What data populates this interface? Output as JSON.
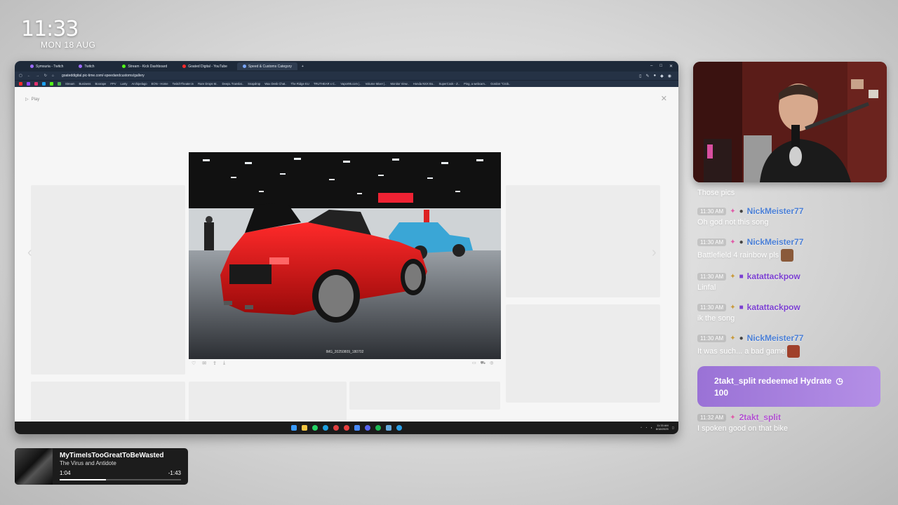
{
  "clock": {
    "time": "11:33",
    "date": "MON 18 AUG"
  },
  "browser": {
    "tabs": [
      {
        "label": "Symsuria - Twitch",
        "active": false
      },
      {
        "label": "Twitch",
        "active": false
      },
      {
        "label": "Stream - Kick Dashboard",
        "active": false
      },
      {
        "label": "Goated Digital - YouTube",
        "active": false
      },
      {
        "label": "Speed & Customs Category",
        "active": true
      }
    ],
    "new_tab": "+",
    "url": "goateddigital.pic-time.com/-speedandcustoms/gallery",
    "bookmarks": [
      "Stream",
      "Business",
      "Boorape",
      "FPV",
      "Lusty",
      "Archipelago",
      "EON - Home",
      "TwitchTheater.tv",
      "Rare Drops M..",
      "DeepL Translat..",
      "Snapdrop",
      "Wax Desk Chat..",
      "The Ridge EU",
      "TRUTHEAR x C..",
      "Vapor95.com |..",
      "Volume Mixer |..",
      "Monitor View..",
      "Honda NSX Bo..",
      "SuperCook - Z..",
      "Ping, a webcam..",
      "Gordon \"Crob.."
    ],
    "play_label": "Play",
    "photo_caption": "IMG_20250809_180702",
    "taskbar_time": "11:33 AM",
    "taskbar_date": "8/18/2025"
  },
  "chat": {
    "partial_text": "Those pics",
    "messages": [
      {
        "time": "11:30 AM",
        "user": "NickMeister77",
        "color": "#4a7fd6",
        "text": "Oh god not this song",
        "emote": false
      },
      {
        "time": "11:30 AM",
        "user": "NickMeister77",
        "color": "#4a7fd6",
        "text": "Battlefield 4 rainbow pls",
        "emote": true
      },
      {
        "time": "11:30 AM",
        "user": "katattackpow",
        "color": "#7b3fd1",
        "text": "Linfal",
        "emote": false
      },
      {
        "time": "11:30 AM",
        "user": "katattackpow",
        "color": "#7b3fd1",
        "text": "ik the song",
        "emote": false
      },
      {
        "time": "11:30 AM",
        "user": "NickMeister77",
        "color": "#4a7fd6",
        "text": "It was such... a bad game",
        "emote": true
      }
    ],
    "redeem": {
      "text": "2takt_split redeemed Hydrate",
      "cost": "100"
    },
    "last": {
      "time": "11:32 AM",
      "user": "2takt_split",
      "color": "#b04fd0",
      "text": "I spoken good on that bike"
    }
  },
  "now_playing": {
    "song": "MyTimeIsTooGreatToBeWasted",
    "artist": "The Virus and Antidote",
    "elapsed": "1:04",
    "remaining": "-1:43",
    "progress": 0.38
  },
  "colors": {
    "accent": "#9a72d6",
    "chrome": "#253245"
  }
}
